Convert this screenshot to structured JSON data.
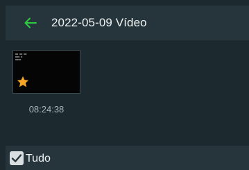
{
  "header": {
    "title": "2022-05-09 Vídeo",
    "back_icon": "arrow-left-icon",
    "back_icon_color": "#2ecc40"
  },
  "videos": [
    {
      "time": "08:24:38",
      "favorite": true,
      "favorite_icon": "star-icon",
      "favorite_color": "#f5a623"
    }
  ],
  "footer": {
    "select_all_label": "Tudo",
    "select_all_checked": true
  },
  "colors": {
    "background": "#1c2a30",
    "bar": "#26353c",
    "accent": "#2ecc40"
  }
}
